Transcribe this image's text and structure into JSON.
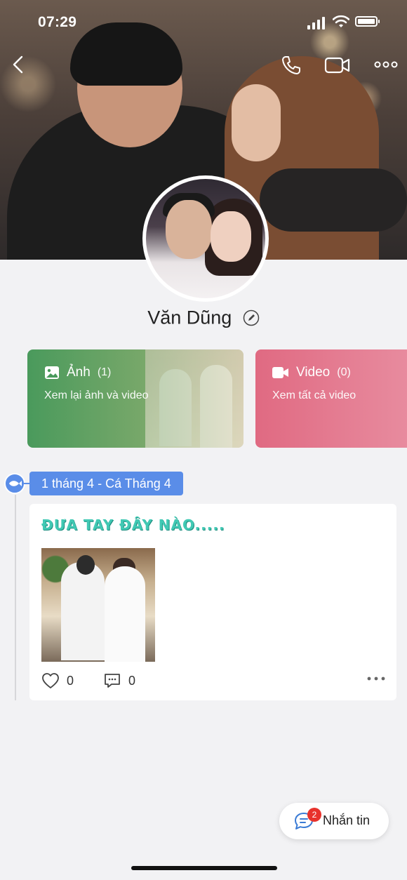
{
  "status": {
    "time": "07:29"
  },
  "profile": {
    "name": "Văn Dũng"
  },
  "cards": {
    "photo": {
      "title": "Ảnh",
      "count": "(1)",
      "subtitle": "Xem lại ảnh và video"
    },
    "video": {
      "title": "Video",
      "count": "(0)",
      "subtitle": "Xem tất cả video"
    }
  },
  "timeline": {
    "label": "1 tháng 4 - Cá Tháng 4"
  },
  "post": {
    "title": "ĐƯA TAY ĐÂY NÀO.....",
    "likes": "0",
    "comments": "0"
  },
  "chat": {
    "badge": "2",
    "label": "Nhắn tin"
  },
  "icons": {
    "back": "chevron-left-icon",
    "call": "phone-icon",
    "video": "video-camera-icon",
    "more": "more-horizontal-icon",
    "edit": "pencil-icon",
    "photo": "image-icon",
    "video_card": "video-camera-icon",
    "like": "heart-icon",
    "comment": "comment-icon",
    "chat": "chat-bubble-icon"
  },
  "colors": {
    "accent": "#5a8de8",
    "photo_card": "#4a9a5c",
    "video_card": "#e06a82",
    "post_title": "#41c9b4",
    "badge": "#e8322c"
  }
}
